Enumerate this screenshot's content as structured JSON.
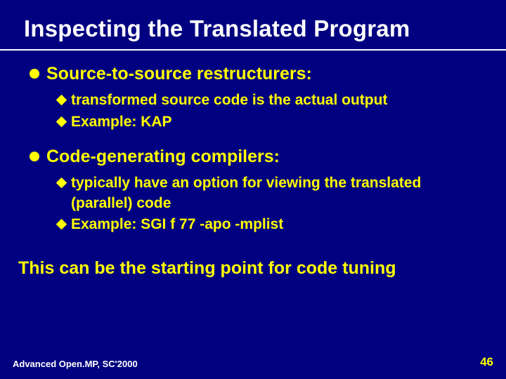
{
  "title": "Inspecting the Translated Program",
  "sections": [
    {
      "head": "Source-to-source restructurers:",
      "subs": [
        "transformed source code is the actual output",
        "Example: KAP"
      ]
    },
    {
      "head": "Code-generating compilers:",
      "subs": [
        "typically have an option for viewing the translated (parallel) code",
        "Example: SGI f 77 -apo -mplist"
      ]
    }
  ],
  "tail": "This can be the starting point for code tuning",
  "footer": {
    "left": "Advanced Open.MP, SC'2000",
    "page": "46"
  }
}
